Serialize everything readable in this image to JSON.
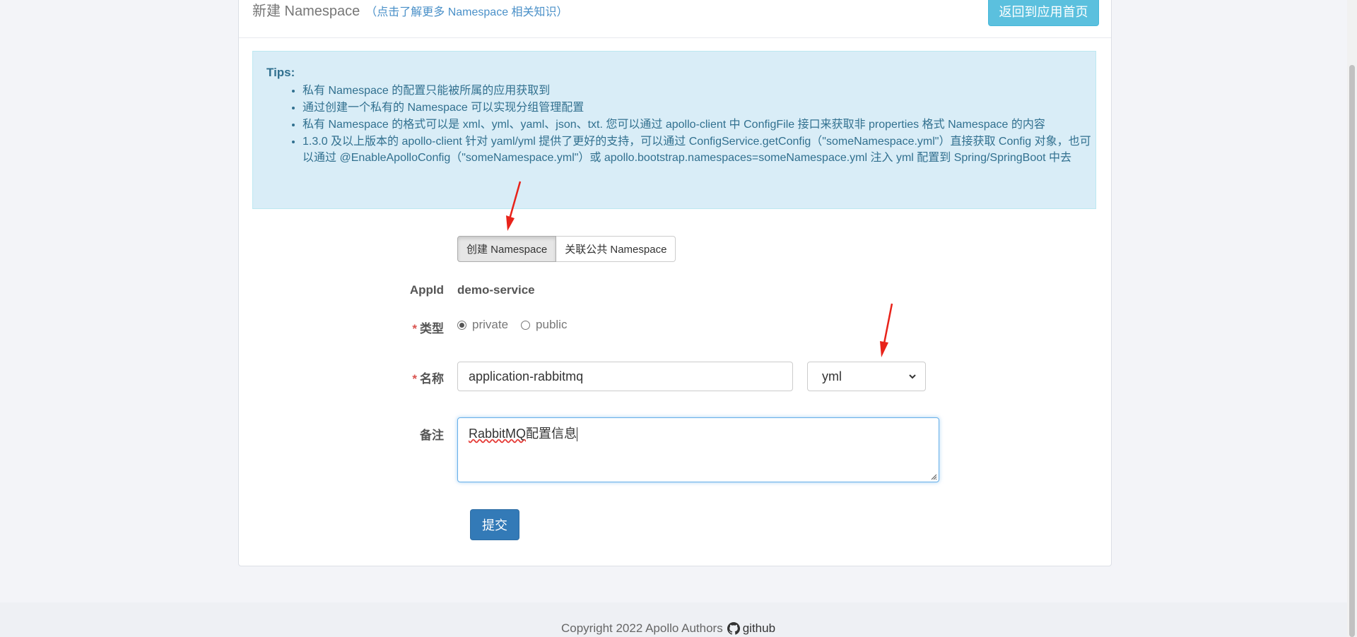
{
  "header": {
    "title": "新建 Namespace",
    "help_link": "（点击了解更多 Namespace 相关知识）",
    "back_button": "返回到应用首页"
  },
  "tips": {
    "title": "Tips:",
    "items": [
      "私有 Namespace 的配置只能被所属的应用获取到",
      "通过创建一个私有的 Namespace 可以实现分组管理配置",
      "私有 Namespace 的格式可以是 xml、yml、yaml、json、txt. 您可以通过 apollo-client 中 ConfigFile 接口来获取非 properties 格式 Namespace 的内容",
      "1.3.0 及以上版本的 apollo-client 针对 yaml/yml 提供了更好的支持，可以通过 ConfigService.getConfig（\"someNamespace.yml\"）直接获取 Config 对象，也可以通过 @EnableApolloConfig（\"someNamespace.yml\"）或 apollo.bootstrap.namespaces=someNamespace.yml 注入 yml 配置到 Spring/SpringBoot 中去"
    ]
  },
  "mode_tabs": {
    "create": "创建 Namespace",
    "link_public": "关联公共 Namespace",
    "active": "create"
  },
  "form": {
    "appid_label": "AppId",
    "appid_value": "demo-service",
    "required_mark": "*",
    "type_label": "类型",
    "type_options": [
      "private",
      "public"
    ],
    "type_selected": "private",
    "name_label": "名称",
    "name_value": "application-rabbitmq",
    "format_selected": "yml",
    "comment_label": "备注",
    "comment_value_word1": "RabbitMQ",
    "comment_value_rest": "配置信息",
    "submit": "提交"
  },
  "footer": {
    "copyright": "Copyright 2022 Apollo Authors",
    "github": "github"
  },
  "colors": {
    "tips_background": "#d9edf7",
    "tips_text": "#31708f",
    "back_button": "#5bc0de",
    "submit_button": "#337ab7",
    "annotation_arrow": "#e8231a",
    "required": "#d9534f"
  },
  "icons": [
    "github-icon",
    "chevron-down-icon",
    "radio-checked-icon",
    "radio-unchecked-icon",
    "resize-grip-icon",
    "annotation-arrow"
  ]
}
